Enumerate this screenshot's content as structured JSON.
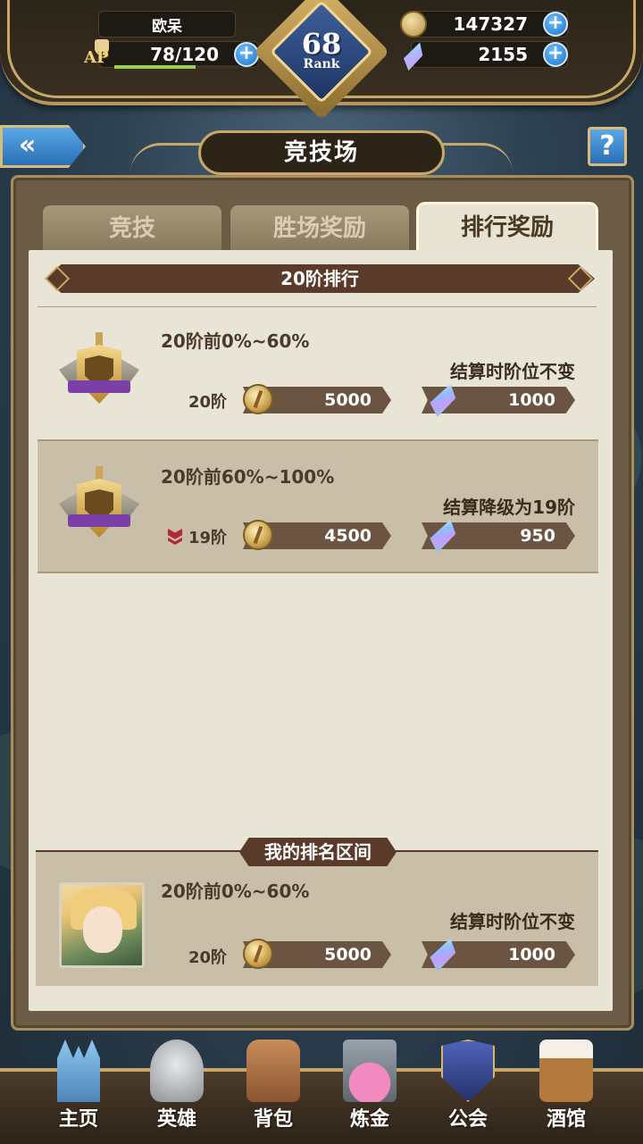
{
  "header": {
    "player_name": "欧呆",
    "ap_label": "AP",
    "ap_value": "78/120",
    "ap_fraction": 0.65,
    "rank_number": "68",
    "rank_label": "Rank",
    "gold": "147327",
    "gems": "2155"
  },
  "title": {
    "text": "竞技场",
    "back_icon": "back-arrow-icon",
    "help_label": "?"
  },
  "tabs": [
    {
      "label": "竞技",
      "active": false
    },
    {
      "label": "胜场奖励",
      "active": false
    },
    {
      "label": "排行奖励",
      "active": true
    }
  ],
  "section": {
    "title": "20阶排行"
  },
  "rewards": [
    {
      "condition": "20阶前0%~60%",
      "tier": "20阶",
      "result": "结算时阶位不变",
      "gold": "5000",
      "gems": "1000",
      "demote": false
    },
    {
      "condition": "20阶前60%~100%",
      "tier": "19阶",
      "result": "结算降级为19阶",
      "gold": "4500",
      "gems": "950",
      "demote": true
    }
  ],
  "my_rank": {
    "title": "我的排名区间",
    "condition": "20阶前0%~60%",
    "tier": "20阶",
    "result": "结算时阶位不变",
    "gold": "5000",
    "gems": "1000"
  },
  "nav": [
    {
      "label": "主页",
      "icon": "castle-icon"
    },
    {
      "label": "英雄",
      "icon": "knight-helmet-icon"
    },
    {
      "label": "背包",
      "icon": "backpack-icon"
    },
    {
      "label": "炼金",
      "icon": "potion-icon"
    },
    {
      "label": "公会",
      "icon": "guild-shield-icon"
    },
    {
      "label": "酒馆",
      "icon": "tavern-icon"
    }
  ],
  "colors": {
    "accent_gold": "#c9a867",
    "header_brown": "#5a3a28",
    "ap_bar": "#9bd04a",
    "demote_red": "#b0283a"
  }
}
